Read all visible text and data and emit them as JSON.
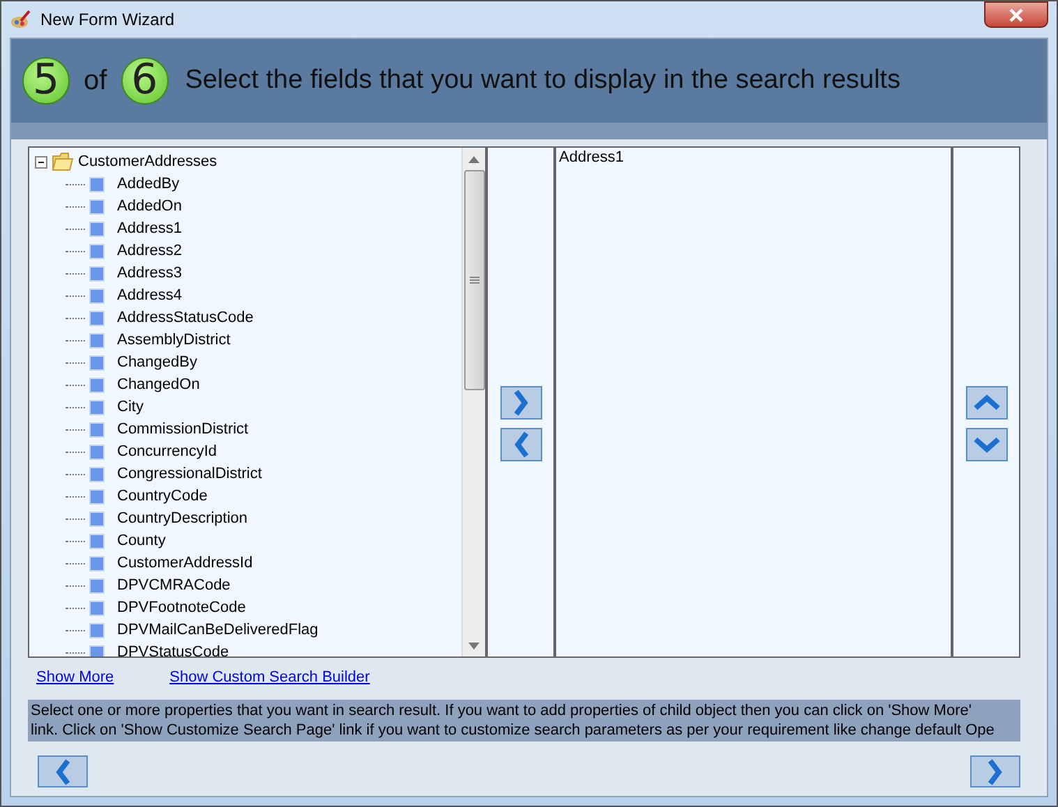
{
  "window": {
    "title": "New Form Wizard"
  },
  "header": {
    "step": "5",
    "of": "of",
    "total": "6",
    "title": "Select the fields that you want to display in the search results"
  },
  "tree": {
    "label": "CustomerAddresses",
    "expanded": true,
    "children": [
      {
        "label": "AddedBy"
      },
      {
        "label": "AddedOn"
      },
      {
        "label": "Address1"
      },
      {
        "label": "Address2"
      },
      {
        "label": "Address3"
      },
      {
        "label": "Address4"
      },
      {
        "label": "AddressStatusCode"
      },
      {
        "label": "AssemblyDistrict"
      },
      {
        "label": "ChangedBy"
      },
      {
        "label": "ChangedOn"
      },
      {
        "label": "City"
      },
      {
        "label": "CommissionDistrict"
      },
      {
        "label": "ConcurrencyId"
      },
      {
        "label": "CongressionalDistrict"
      },
      {
        "label": "CountryCode"
      },
      {
        "label": "CountryDescription"
      },
      {
        "label": "County"
      },
      {
        "label": "CustomerAddressId"
      },
      {
        "label": "DPVCMRACode"
      },
      {
        "label": "DPVFootnoteCode"
      },
      {
        "label": "DPVMailCanBeDeliveredFlag"
      },
      {
        "label": "DPVStatusCode"
      }
    ]
  },
  "selected_fields": [
    "Address1"
  ],
  "links": [
    "Show More",
    "Show Custom Search Builder"
  ],
  "info_lines": [
    "Select one or more properties that you want in search result. If you want to add properties of child object then you can click on 'Show More'",
    "link. Click on 'Show Customize Search Page' link if you want to customize search parameters as per your requirement like change default Ope"
  ]
}
